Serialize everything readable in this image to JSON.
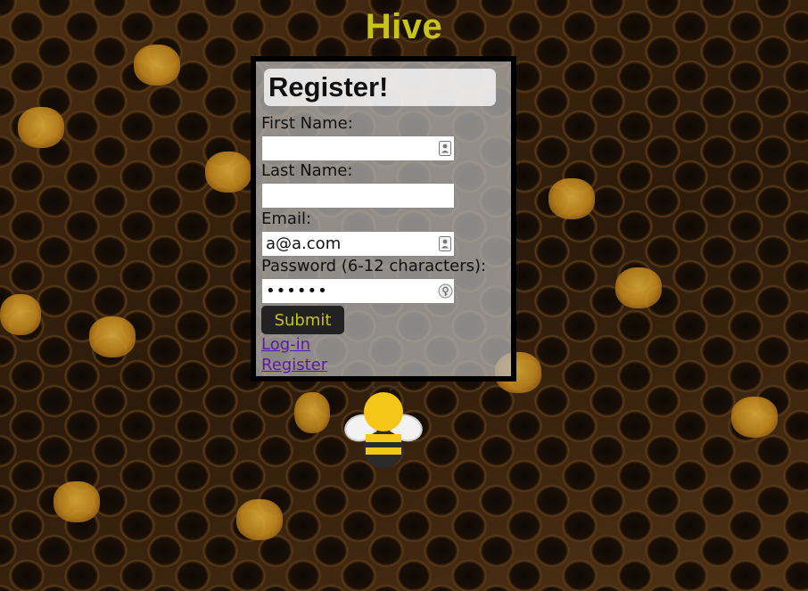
{
  "app": {
    "title": "Hive"
  },
  "form": {
    "heading": "Register!",
    "first_name": {
      "label": "First Name:",
      "value": ""
    },
    "last_name": {
      "label": "Last Name:",
      "value": ""
    },
    "email": {
      "label": "Email:",
      "value": "a@a.com"
    },
    "password": {
      "label": "Password (6-12 characters):",
      "value": "••••••"
    },
    "submit_label": "Submit"
  },
  "links": {
    "login": "Log-in",
    "register": "Register"
  },
  "icons": {
    "contact_card": "contact-card-icon",
    "password_key": "password-key-icon",
    "bee": "bee-icon"
  },
  "colors": {
    "title": "#c8c317",
    "panel_border": "#000000",
    "submit_bg": "#222222",
    "submit_text": "#c8c317",
    "link": "#5a1aa0"
  }
}
